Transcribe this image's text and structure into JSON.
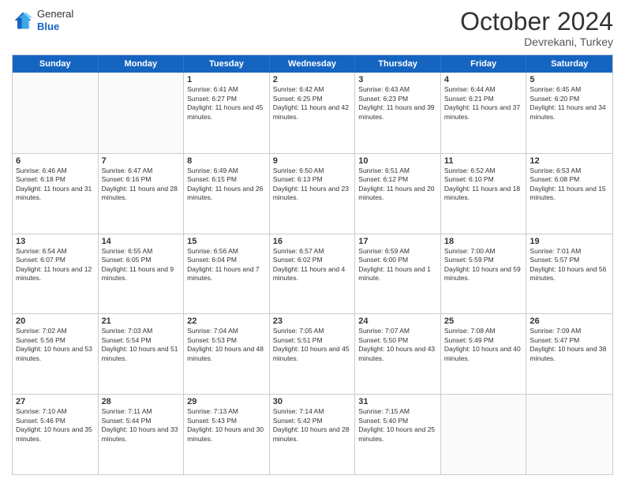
{
  "header": {
    "logo_line1": "General",
    "logo_line2": "Blue",
    "month": "October 2024",
    "location": "Devrekani, Turkey"
  },
  "weekdays": [
    "Sunday",
    "Monday",
    "Tuesday",
    "Wednesday",
    "Thursday",
    "Friday",
    "Saturday"
  ],
  "weeks": [
    [
      {
        "day": "",
        "info": ""
      },
      {
        "day": "",
        "info": ""
      },
      {
        "day": "1",
        "info": "Sunrise: 6:41 AM\nSunset: 6:27 PM\nDaylight: 11 hours and 45 minutes."
      },
      {
        "day": "2",
        "info": "Sunrise: 6:42 AM\nSunset: 6:25 PM\nDaylight: 11 hours and 42 minutes."
      },
      {
        "day": "3",
        "info": "Sunrise: 6:43 AM\nSunset: 6:23 PM\nDaylight: 11 hours and 39 minutes."
      },
      {
        "day": "4",
        "info": "Sunrise: 6:44 AM\nSunset: 6:21 PM\nDaylight: 11 hours and 37 minutes."
      },
      {
        "day": "5",
        "info": "Sunrise: 6:45 AM\nSunset: 6:20 PM\nDaylight: 11 hours and 34 minutes."
      }
    ],
    [
      {
        "day": "6",
        "info": "Sunrise: 6:46 AM\nSunset: 6:18 PM\nDaylight: 11 hours and 31 minutes."
      },
      {
        "day": "7",
        "info": "Sunrise: 6:47 AM\nSunset: 6:16 PM\nDaylight: 11 hours and 28 minutes."
      },
      {
        "day": "8",
        "info": "Sunrise: 6:49 AM\nSunset: 6:15 PM\nDaylight: 11 hours and 26 minutes."
      },
      {
        "day": "9",
        "info": "Sunrise: 6:50 AM\nSunset: 6:13 PM\nDaylight: 11 hours and 23 minutes."
      },
      {
        "day": "10",
        "info": "Sunrise: 6:51 AM\nSunset: 6:12 PM\nDaylight: 11 hours and 20 minutes."
      },
      {
        "day": "11",
        "info": "Sunrise: 6:52 AM\nSunset: 6:10 PM\nDaylight: 11 hours and 18 minutes."
      },
      {
        "day": "12",
        "info": "Sunrise: 6:53 AM\nSunset: 6:08 PM\nDaylight: 11 hours and 15 minutes."
      }
    ],
    [
      {
        "day": "13",
        "info": "Sunrise: 6:54 AM\nSunset: 6:07 PM\nDaylight: 11 hours and 12 minutes."
      },
      {
        "day": "14",
        "info": "Sunrise: 6:55 AM\nSunset: 6:05 PM\nDaylight: 11 hours and 9 minutes."
      },
      {
        "day": "15",
        "info": "Sunrise: 6:56 AM\nSunset: 6:04 PM\nDaylight: 11 hours and 7 minutes."
      },
      {
        "day": "16",
        "info": "Sunrise: 6:57 AM\nSunset: 6:02 PM\nDaylight: 11 hours and 4 minutes."
      },
      {
        "day": "17",
        "info": "Sunrise: 6:59 AM\nSunset: 6:00 PM\nDaylight: 11 hours and 1 minute."
      },
      {
        "day": "18",
        "info": "Sunrise: 7:00 AM\nSunset: 5:59 PM\nDaylight: 10 hours and 59 minutes."
      },
      {
        "day": "19",
        "info": "Sunrise: 7:01 AM\nSunset: 5:57 PM\nDaylight: 10 hours and 56 minutes."
      }
    ],
    [
      {
        "day": "20",
        "info": "Sunrise: 7:02 AM\nSunset: 5:56 PM\nDaylight: 10 hours and 53 minutes."
      },
      {
        "day": "21",
        "info": "Sunrise: 7:03 AM\nSunset: 5:54 PM\nDaylight: 10 hours and 51 minutes."
      },
      {
        "day": "22",
        "info": "Sunrise: 7:04 AM\nSunset: 5:53 PM\nDaylight: 10 hours and 48 minutes."
      },
      {
        "day": "23",
        "info": "Sunrise: 7:05 AM\nSunset: 5:51 PM\nDaylight: 10 hours and 45 minutes."
      },
      {
        "day": "24",
        "info": "Sunrise: 7:07 AM\nSunset: 5:50 PM\nDaylight: 10 hours and 43 minutes."
      },
      {
        "day": "25",
        "info": "Sunrise: 7:08 AM\nSunset: 5:49 PM\nDaylight: 10 hours and 40 minutes."
      },
      {
        "day": "26",
        "info": "Sunrise: 7:09 AM\nSunset: 5:47 PM\nDaylight: 10 hours and 38 minutes."
      }
    ],
    [
      {
        "day": "27",
        "info": "Sunrise: 7:10 AM\nSunset: 5:46 PM\nDaylight: 10 hours and 35 minutes."
      },
      {
        "day": "28",
        "info": "Sunrise: 7:11 AM\nSunset: 5:44 PM\nDaylight: 10 hours and 33 minutes."
      },
      {
        "day": "29",
        "info": "Sunrise: 7:13 AM\nSunset: 5:43 PM\nDaylight: 10 hours and 30 minutes."
      },
      {
        "day": "30",
        "info": "Sunrise: 7:14 AM\nSunset: 5:42 PM\nDaylight: 10 hours and 28 minutes."
      },
      {
        "day": "31",
        "info": "Sunrise: 7:15 AM\nSunset: 5:40 PM\nDaylight: 10 hours and 25 minutes."
      },
      {
        "day": "",
        "info": ""
      },
      {
        "day": "",
        "info": ""
      }
    ]
  ]
}
